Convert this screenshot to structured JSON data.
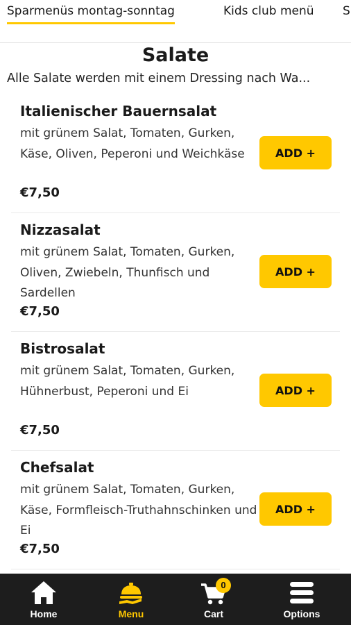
{
  "tabs": [
    {
      "label": "Sparmenüs montag-sonntag",
      "active": true
    },
    {
      "label": "Kids club menü",
      "active": false
    },
    {
      "label": "S",
      "active": false
    }
  ],
  "section": {
    "title": "Salate",
    "description": "Alle Salate werden mit einem Dressing nach Wa..."
  },
  "items": [
    {
      "name": "Italienischer Bauernsalat",
      "description": "mit grünem Salat, Tomaten, Gurken, Käse, Oliven, Peperoni und Weichkäse",
      "price": "€7,50",
      "button": "ADD +"
    },
    {
      "name": "Nizzasalat",
      "description": "mit grünem Salat, Tomaten, Gurken, Oliven, Zwiebeln, Thunfisch und Sardellen",
      "price": "€7,50",
      "button": "ADD +"
    },
    {
      "name": "Bistrosalat",
      "description": "mit grünem Salat, Tomaten, Gurken, Hühnerbust, Peperoni und Ei",
      "price": "€7,50",
      "button": "ADD +"
    },
    {
      "name": "Chefsalat",
      "description": "mit grünem Salat, Tomaten, Gurken, Käse, Formfleisch-Truthahnschinken und Ei",
      "price": "€7,50",
      "button": "ADD +"
    }
  ],
  "nav": {
    "home": "Home",
    "menu": "Menu",
    "cart": "Cart",
    "options": "Options",
    "cart_count": "0",
    "active": "menu"
  },
  "colors": {
    "accent": "#ffc800",
    "nav_background": "#1d1d1d"
  },
  "icons": {
    "home": "home-icon",
    "menu": "serving-cloche-icon",
    "cart": "shopping-cart-icon",
    "options": "hamburger-menu-icon"
  }
}
